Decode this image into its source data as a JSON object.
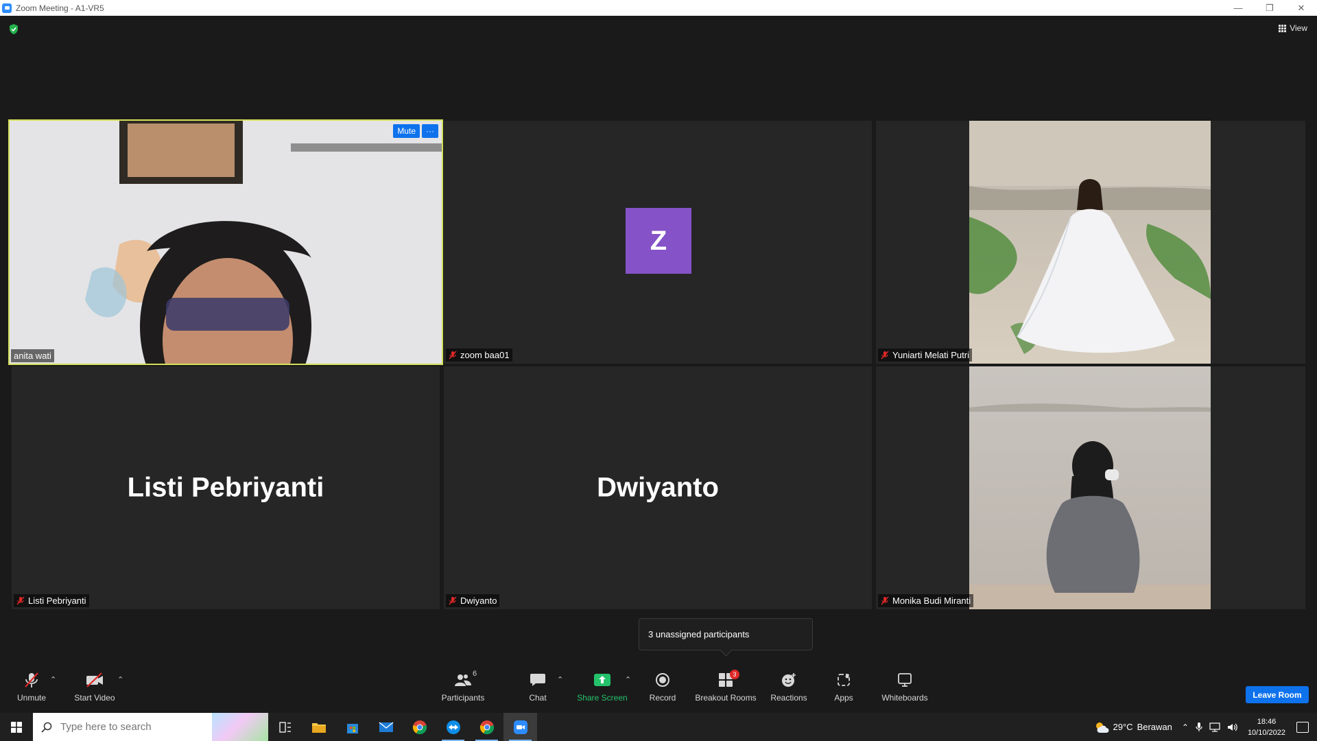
{
  "window": {
    "title": "Zoom Meeting - A1-VR5"
  },
  "top_bar": {
    "view_label": "View"
  },
  "tiles": [
    {
      "name": "anita wati",
      "type": "video",
      "active": true,
      "mute_label": "Mute",
      "more_label": "···"
    },
    {
      "name": "zoom baa01",
      "type": "avatar",
      "avatar_letter": "Z",
      "avatar_color": "#8552c7"
    },
    {
      "name": "Yuniarti Melati Putri",
      "type": "video"
    },
    {
      "name": "Listi Pebriyanti",
      "type": "name",
      "display_name": "Listi Pebriyanti"
    },
    {
      "name": "Dwiyanto",
      "type": "name",
      "display_name": "Dwiyanto"
    },
    {
      "name": "Monika Budi Miranti",
      "type": "video"
    }
  ],
  "tooltip": {
    "text": "3 unassigned participants"
  },
  "toolbar": {
    "unmute": "Unmute",
    "start_video": "Start Video",
    "participants": "Participants",
    "participants_count": "6",
    "chat": "Chat",
    "share_screen": "Share Screen",
    "record": "Record",
    "breakout_rooms": "Breakout Rooms",
    "breakout_count": "3",
    "reactions": "Reactions",
    "apps": "Apps",
    "whiteboards": "Whiteboards",
    "leave": "Leave Room"
  },
  "taskbar": {
    "search_placeholder": "Type here to search",
    "weather_temp": "29°C",
    "weather_desc": "Berawan",
    "time": "18:46",
    "date": "10/10/2022"
  },
  "colors": {
    "accent": "#0e72ed",
    "active_border": "#d5e05a",
    "share_green": "#24c36b"
  }
}
